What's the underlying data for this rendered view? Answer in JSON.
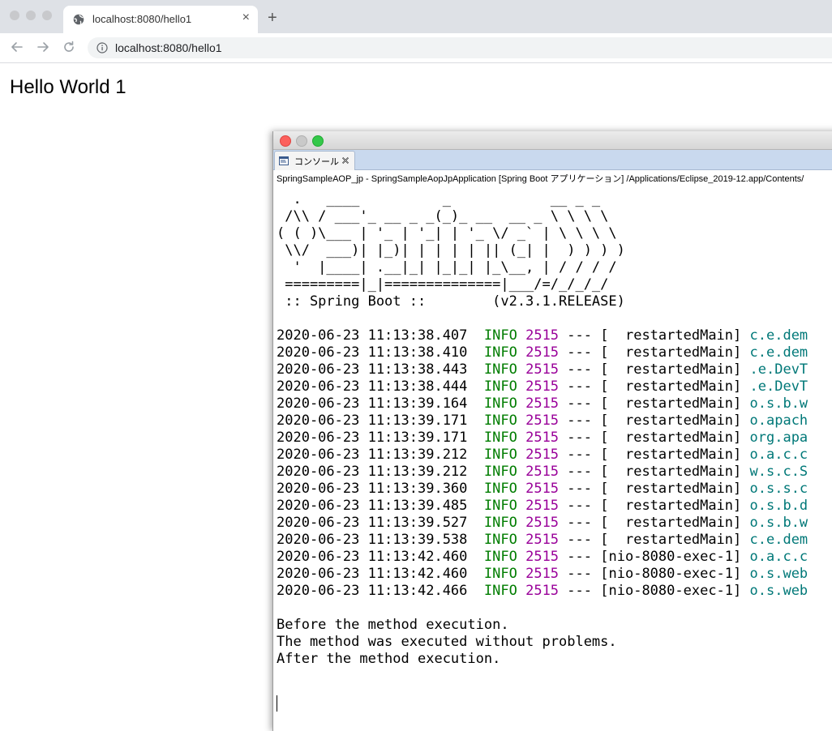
{
  "browser": {
    "tab_title": "localhost:8080/hello1",
    "tab_close": "×",
    "new_tab": "+",
    "address": "localhost:8080/hello1"
  },
  "page": {
    "heading": "Hello World 1"
  },
  "console": {
    "tab_label": "コンソール",
    "launch_info": "SpringSampleAOP_jp - SpringSampleAopJpApplication [Spring Boot アプリケーション] /Applications/Eclipse_2019-12.app/Contents/",
    "banner": [
      "  .   ____          _            __ _ _",
      " /\\\\ / ___'_ __ _ _(_)_ __  __ _ \\ \\ \\ \\",
      "( ( )\\___ | '_ | '_| | '_ \\/ _` | \\ \\ \\ \\",
      " \\\\/  ___)| |_)| | | | | || (_| |  ) ) ) )",
      "  '  |____| .__|_| |_|_| |_\\__, | / / / /",
      " =========|_|==============|___/=/_/_/_/"
    ],
    "spring_boot_label": " :: Spring Boot :: ",
    "spring_boot_version": "       (v2.3.1.RELEASE)",
    "log_rows": [
      {
        "ts": "2020-06-23 11:13:38.407",
        "level": "INFO",
        "pid": "2515",
        "sep": "---",
        "thread": "[  restartedMain]",
        "logger": "c.e.dem"
      },
      {
        "ts": "2020-06-23 11:13:38.410",
        "level": "INFO",
        "pid": "2515",
        "sep": "---",
        "thread": "[  restartedMain]",
        "logger": "c.e.dem"
      },
      {
        "ts": "2020-06-23 11:13:38.443",
        "level": "INFO",
        "pid": "2515",
        "sep": "---",
        "thread": "[  restartedMain]",
        "logger": ".e.DevT"
      },
      {
        "ts": "2020-06-23 11:13:38.444",
        "level": "INFO",
        "pid": "2515",
        "sep": "---",
        "thread": "[  restartedMain]",
        "logger": ".e.DevT"
      },
      {
        "ts": "2020-06-23 11:13:39.164",
        "level": "INFO",
        "pid": "2515",
        "sep": "---",
        "thread": "[  restartedMain]",
        "logger": "o.s.b.w"
      },
      {
        "ts": "2020-06-23 11:13:39.171",
        "level": "INFO",
        "pid": "2515",
        "sep": "---",
        "thread": "[  restartedMain]",
        "logger": "o.apach"
      },
      {
        "ts": "2020-06-23 11:13:39.171",
        "level": "INFO",
        "pid": "2515",
        "sep": "---",
        "thread": "[  restartedMain]",
        "logger": "org.apa"
      },
      {
        "ts": "2020-06-23 11:13:39.212",
        "level": "INFO",
        "pid": "2515",
        "sep": "---",
        "thread": "[  restartedMain]",
        "logger": "o.a.c.c"
      },
      {
        "ts": "2020-06-23 11:13:39.212",
        "level": "INFO",
        "pid": "2515",
        "sep": "---",
        "thread": "[  restartedMain]",
        "logger": "w.s.c.S"
      },
      {
        "ts": "2020-06-23 11:13:39.360",
        "level": "INFO",
        "pid": "2515",
        "sep": "---",
        "thread": "[  restartedMain]",
        "logger": "o.s.s.c"
      },
      {
        "ts": "2020-06-23 11:13:39.485",
        "level": "INFO",
        "pid": "2515",
        "sep": "---",
        "thread": "[  restartedMain]",
        "logger": "o.s.b.d"
      },
      {
        "ts": "2020-06-23 11:13:39.527",
        "level": "INFO",
        "pid": "2515",
        "sep": "---",
        "thread": "[  restartedMain]",
        "logger": "o.s.b.w"
      },
      {
        "ts": "2020-06-23 11:13:39.538",
        "level": "INFO",
        "pid": "2515",
        "sep": "---",
        "thread": "[  restartedMain]",
        "logger": "c.e.dem"
      },
      {
        "ts": "2020-06-23 11:13:42.460",
        "level": "INFO",
        "pid": "2515",
        "sep": "---",
        "thread": "[nio-8080-exec-1]",
        "logger": "o.a.c.c"
      },
      {
        "ts": "2020-06-23 11:13:42.460",
        "level": "INFO",
        "pid": "2515",
        "sep": "---",
        "thread": "[nio-8080-exec-1]",
        "logger": "o.s.web"
      },
      {
        "ts": "2020-06-23 11:13:42.466",
        "level": "INFO",
        "pid": "2515",
        "sep": "---",
        "thread": "[nio-8080-exec-1]",
        "logger": "o.s.web"
      }
    ],
    "messages": [
      "Before the method execution.",
      "The method was executed without problems.",
      "After the method execution."
    ]
  },
  "colors": {
    "level": "#007d00",
    "pid": "#990099",
    "logger": "#007878",
    "banner": "#008000"
  }
}
